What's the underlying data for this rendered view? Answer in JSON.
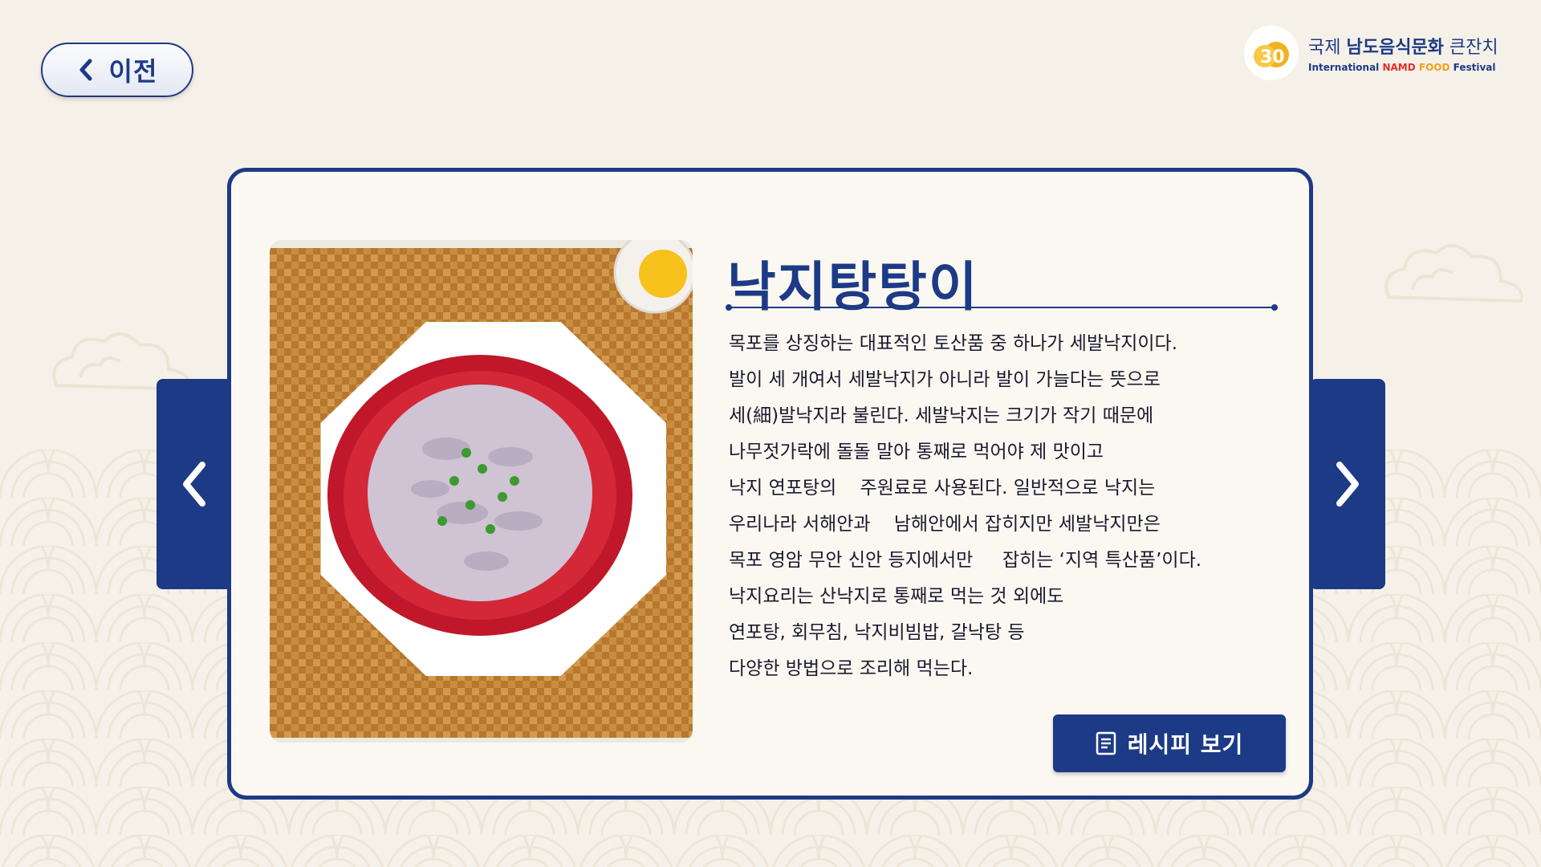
{
  "header": {
    "back_label": "이전",
    "logo": {
      "mark_text": "30",
      "title_prefix": "국제 ",
      "title_bold": "남도음식문화",
      "title_suffix": " 큰잔치",
      "subtitle_prefix": "International ",
      "subtitle_namd": "NAMD ",
      "subtitle_food": "FOOD ",
      "subtitle_suffix": "Festival"
    }
  },
  "nav": {
    "prev_icon": "chevron-left-icon",
    "next_icon": "chevron-right-icon"
  },
  "dish": {
    "name": "낙지탕탕이",
    "description_lines": [
      "목포를 상징하는 대표적인 토산품 중 하나가 세발낙지이다.",
      "발이 세 개여서 세발낙지가 아니라 발이 가늘다는 뜻으로",
      "세(細)발낙지라 불린다. 세발낙지는 크기가 작기 때문에",
      "나무젓가락에 돌돌 말아 통째로 먹어야 제 맛이고",
      "낙지 연포탕의    주원료로 사용된다. 일반적으로 낙지는",
      "우리나라 서해안과    남해안에서 잡히지만 세발낙지만은",
      "목포 영암 무안 신안 등지에서만     잡히는 ‘지역 특산품’이다.",
      "낙지요리는 산낙지로 통째로 먹는 것 외에도",
      "연포탕, 회무침, 낙지비빔밥, 갈낙탕 등",
      "다양한 방법으로 조리해 먹는다."
    ],
    "recipe_button_label": "레시피 보기"
  },
  "colors": {
    "navy": "#1d3a86",
    "background": "#f6f1e8",
    "card": "#fbf8f2"
  }
}
